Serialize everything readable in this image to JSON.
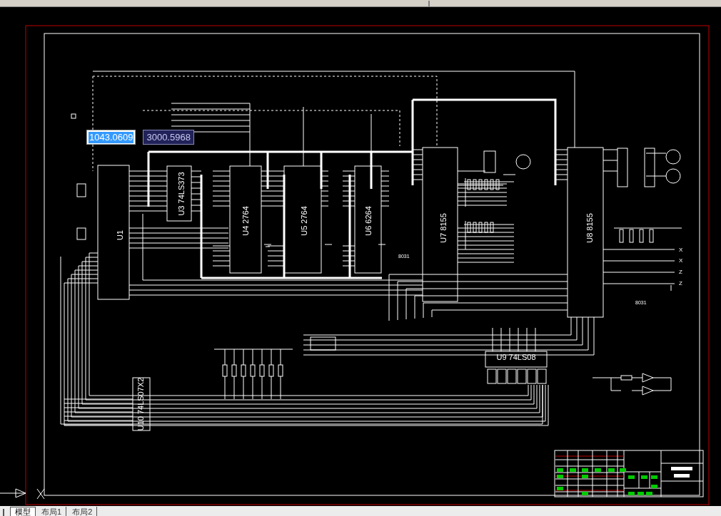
{
  "coordinate_inputs": [
    {
      "value": "1043.0609",
      "selected": true
    },
    {
      "value": "3000.5968",
      "selected": false
    }
  ],
  "chips": [
    {
      "ref": "U1"
    },
    {
      "ref": "U3",
      "part": "74LS373"
    },
    {
      "ref": "U4",
      "part": "2764"
    },
    {
      "ref": "U5",
      "part": "2764"
    },
    {
      "ref": "U6",
      "part": "6264"
    },
    {
      "ref": "U7",
      "part": "8155"
    },
    {
      "ref": "U8",
      "part": "8155"
    },
    {
      "ref": "U9",
      "part": "74LS08"
    },
    {
      "ref": "U10",
      "part": "74LS07X2"
    }
  ],
  "net_labels": [
    "8031",
    "8031"
  ],
  "switch_labels": [
    "X",
    "X",
    "Z",
    "Z"
  ],
  "tabs": [
    {
      "label": "模型",
      "selected": true
    },
    {
      "label": "布局1",
      "selected": false
    },
    {
      "label": "布局2",
      "selected": false
    }
  ]
}
